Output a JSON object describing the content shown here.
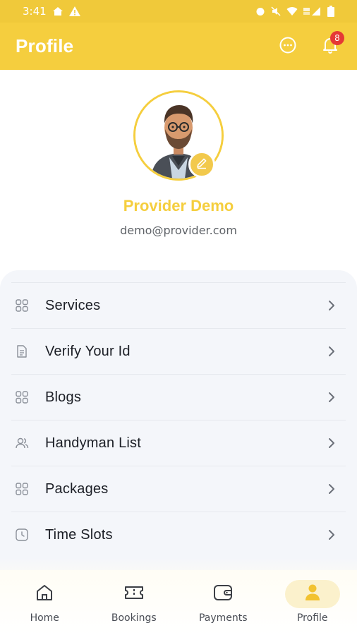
{
  "status_bar": {
    "time": "3:41"
  },
  "app_bar": {
    "title": "Profile",
    "notification_count": "8",
    "chat_icon": "chat-icon",
    "bell_icon": "bell-icon"
  },
  "profile": {
    "name": "Provider Demo",
    "email": "demo@provider.com"
  },
  "menu": [
    {
      "label": "Services",
      "icon": "grid-icon"
    },
    {
      "label": "Verify Your Id",
      "icon": "document-icon"
    },
    {
      "label": "Blogs",
      "icon": "grid-icon"
    },
    {
      "label": "Handyman List",
      "icon": "users-icon"
    },
    {
      "label": "Packages",
      "icon": "grid-icon"
    },
    {
      "label": "Time Slots",
      "icon": "clock-icon"
    }
  ],
  "bottom_nav": [
    {
      "label": "Home",
      "icon": "home-icon",
      "active": false
    },
    {
      "label": "Bookings",
      "icon": "ticket-icon",
      "active": false
    },
    {
      "label": "Payments",
      "icon": "wallet-icon",
      "active": false
    },
    {
      "label": "Profile",
      "icon": "person-icon",
      "active": true
    }
  ],
  "colors": {
    "accent": "#f5ce3e",
    "badge": "#e53935",
    "card_bg": "#f4f6fa"
  }
}
